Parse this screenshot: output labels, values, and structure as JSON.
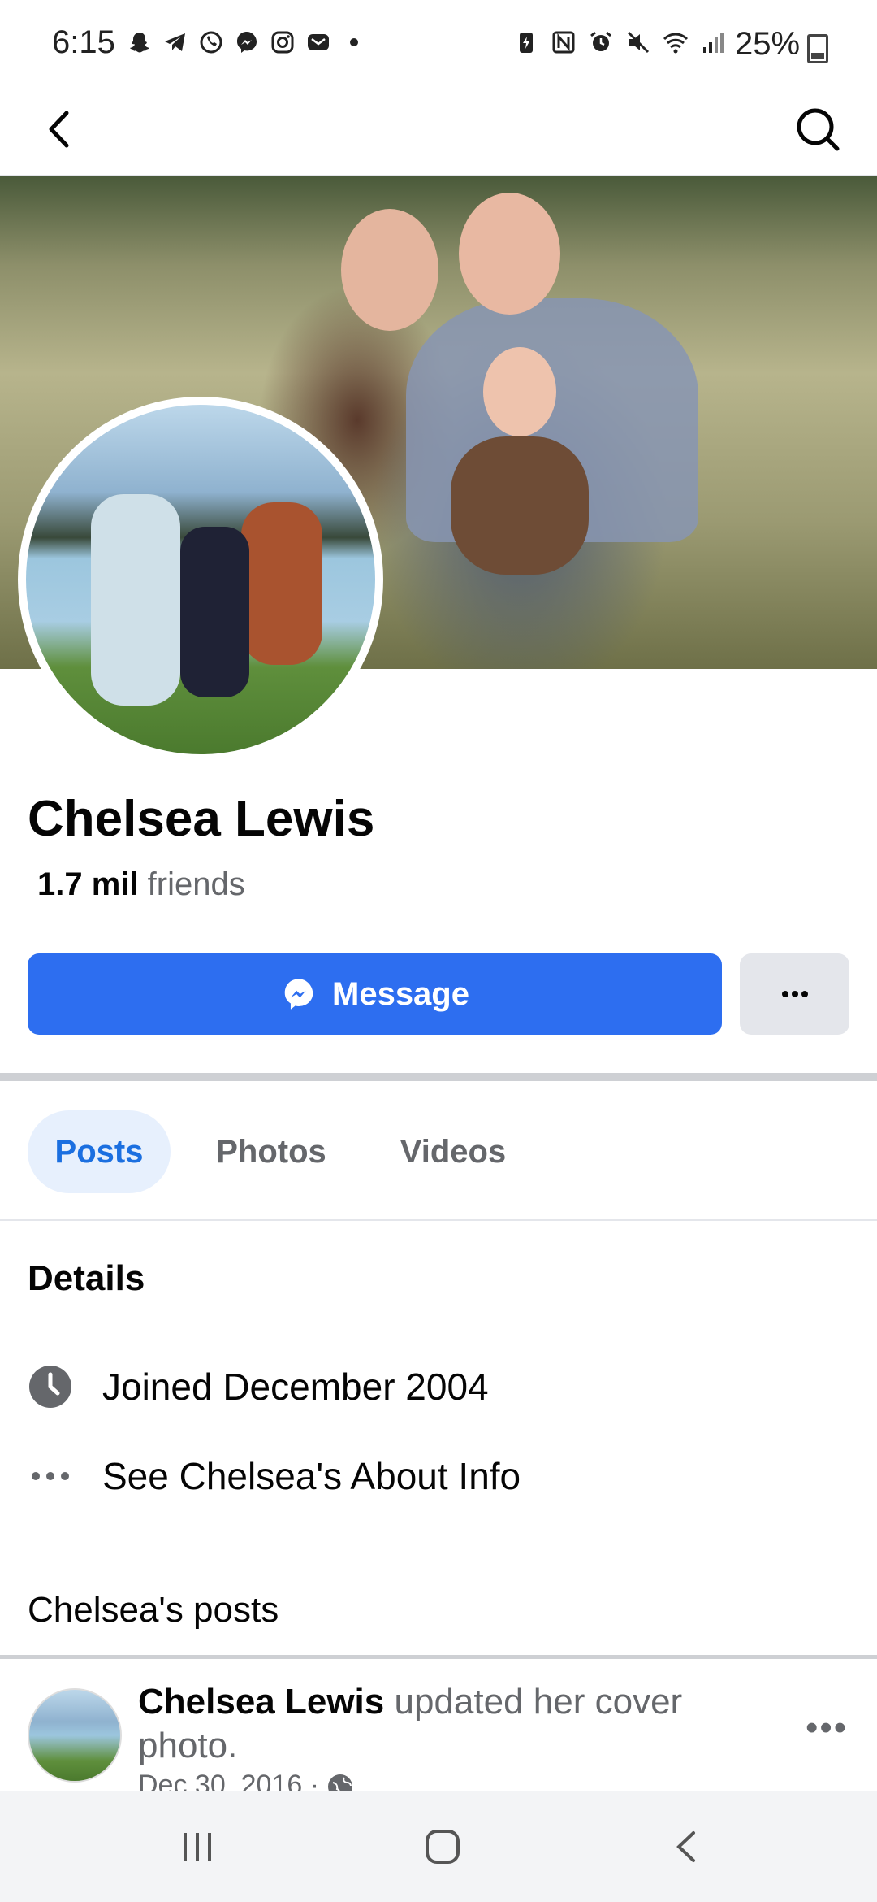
{
  "status_bar": {
    "time": "6:15",
    "battery": "25%",
    "left_icons": [
      "snapchat-icon",
      "telegram-icon",
      "whatsapp-icon",
      "messenger-icon",
      "instagram-icon",
      "mail-icon",
      "dot-icon"
    ],
    "right_icons": [
      "battery-saver-icon",
      "nfc-icon",
      "alarm-icon",
      "mute-icon",
      "wifi-icon",
      "signal-icon"
    ]
  },
  "top_bar": {
    "back_icon": "chevron-left-icon",
    "search_icon": "search-icon"
  },
  "profile": {
    "name": "Chelsea Lewis",
    "friends_count": "1.7 mil",
    "friends_label": "friends"
  },
  "actions": {
    "message_label": "Message",
    "more_label": "···"
  },
  "tabs": [
    {
      "label": "Posts",
      "active": true
    },
    {
      "label": "Photos",
      "active": false
    },
    {
      "label": "Videos",
      "active": false
    }
  ],
  "details": {
    "title": "Details",
    "items": [
      {
        "icon": "clock-icon",
        "text": "Joined December 2004"
      },
      {
        "icon": "more-dots-icon",
        "text": "See Chelsea's About Info"
      }
    ]
  },
  "posts_section": {
    "title": "Chelsea's posts",
    "posts": [
      {
        "author": "Chelsea Lewis",
        "action": "updated her cover photo.",
        "date": "Dec 30, 2016 ·",
        "privacy_icon": "globe-icon",
        "more": "•••"
      }
    ]
  },
  "colors": {
    "accent": "#2d6ef0",
    "tab_active_bg": "#e7f0fd",
    "tab_active_text": "#1b6fe0",
    "secondary_text": "#65676b",
    "divider": "#ced0d4"
  }
}
